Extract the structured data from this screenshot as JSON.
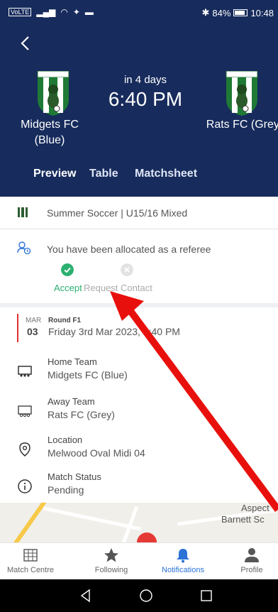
{
  "status_bar": {
    "carrier": "VoLTE",
    "battery": "84%",
    "time": "10:48"
  },
  "match": {
    "countdown": "in 4 days",
    "kickoff": "6:40 PM",
    "home_team": "Midgets FC (Blue)",
    "away_team": "Rats FC (Grey)"
  },
  "tabs": [
    "Preview",
    "Table",
    "Matchsheet"
  ],
  "competition": "Summer Soccer | U15/16 Mixed",
  "referee": {
    "message": "You have been allocated as a referee",
    "accept_label": "Accept",
    "request_label": "Request Contact"
  },
  "round": {
    "month": "MAR",
    "day": "03",
    "name": "Round F1",
    "datetime": "Friday 3rd Mar 2023, 6:40 PM"
  },
  "details": {
    "home": {
      "label": "Home Team",
      "value": "Midgets FC (Blue)"
    },
    "away": {
      "label": "Away Team",
      "value": "Rats FC (Grey)"
    },
    "location": {
      "label": "Location",
      "value": "Melwood Oval Midi 04"
    },
    "status": {
      "label": "Match Status",
      "value": "Pending"
    }
  },
  "map": {
    "label1": "Aspect",
    "label2": "Barnett Sc"
  },
  "bottom_nav": [
    "Match Centre",
    "Following",
    "Notifications",
    "Profile"
  ],
  "colors": {
    "header_bg": "#172b5c",
    "accept_green": "#2bb06f",
    "active_blue": "#2a72d6",
    "arrow_red": "#e8100c"
  }
}
